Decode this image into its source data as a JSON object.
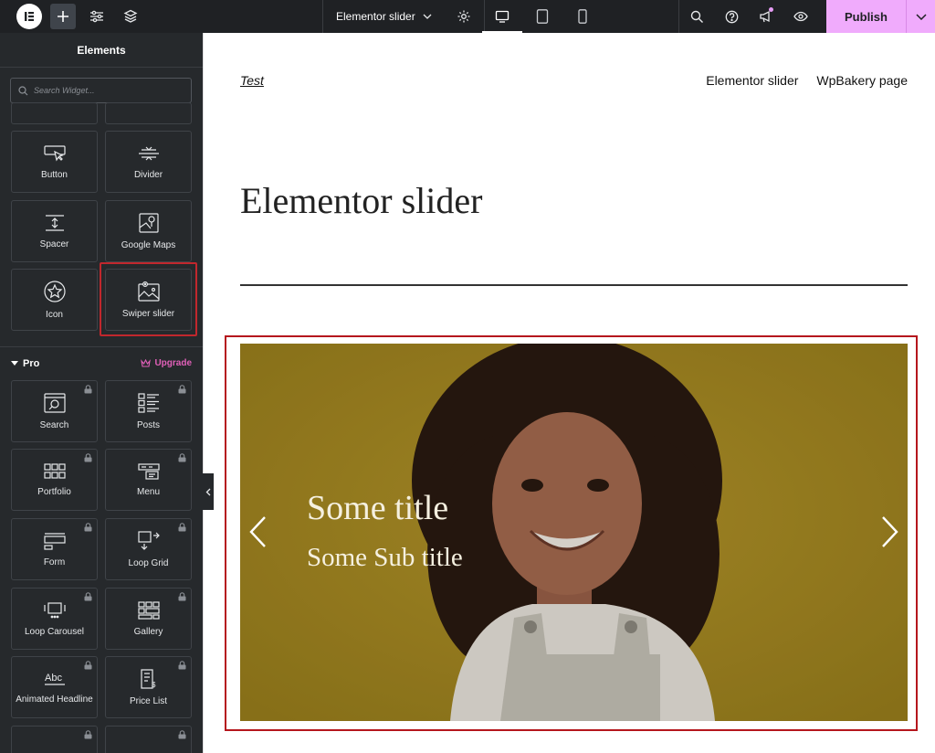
{
  "topbar": {
    "document_title": "Elementor slider",
    "publish_label": "Publish"
  },
  "sidebar": {
    "header": "Elements",
    "search_placeholder": "Search Widget...",
    "widgets": [
      {
        "label": "Button",
        "icon": "button-cursor-icon"
      },
      {
        "label": "Divider",
        "icon": "divider-icon"
      },
      {
        "label": "Spacer",
        "icon": "spacer-icon"
      },
      {
        "label": "Google Maps",
        "icon": "map-icon"
      },
      {
        "label": "Icon",
        "icon": "star-icon"
      },
      {
        "label": "Swiper slider",
        "icon": "image-slider-icon"
      }
    ],
    "pro": {
      "title": "Pro",
      "upgrade_label": "Upgrade",
      "widgets": [
        {
          "label": "Search",
          "icon": "search-widget-icon"
        },
        {
          "label": "Posts",
          "icon": "posts-icon"
        },
        {
          "label": "Portfolio",
          "icon": "portfolio-icon"
        },
        {
          "label": "Menu",
          "icon": "menu-icon"
        },
        {
          "label": "Form",
          "icon": "form-icon"
        },
        {
          "label": "Loop Grid",
          "icon": "loop-grid-icon"
        },
        {
          "label": "Loop Carousel",
          "icon": "loop-carousel-icon"
        },
        {
          "label": "Gallery",
          "icon": "gallery-icon"
        },
        {
          "label": "Animated Headline",
          "icon": "animated-headline-icon"
        },
        {
          "label": "Price List",
          "icon": "price-list-icon"
        }
      ]
    }
  },
  "canvas": {
    "site_title": "Test",
    "nav": [
      "Elementor slider",
      "WpBakery page"
    ],
    "page_title": "Elementor slider",
    "slide": {
      "title": "Some title",
      "subtitle": "Some Sub title"
    }
  },
  "colors": {
    "topbar_bg": "#1f2124",
    "sidebar_bg": "#26292c",
    "publish_bg": "#f0abfc",
    "upgrade": "#e060b8",
    "highlight": "#c1272d",
    "slide_bg": "#a78a1f"
  }
}
